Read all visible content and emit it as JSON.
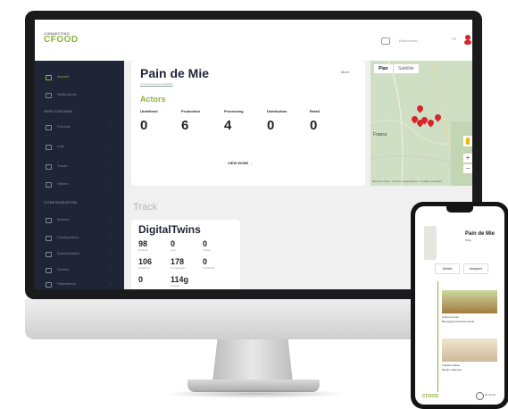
{
  "app": {
    "logo_top": "CONNECTING",
    "logo_main": "CFOOD",
    "search_placeholder": "Rechercher...",
    "language": "FR"
  },
  "sidebar": {
    "items_top": [
      {
        "label": "Accueil",
        "active": true
      },
      {
        "label": "Notifications",
        "active": false
      }
    ],
    "section_applications": "APPLICATIONS",
    "items_apps": [
      {
        "label": "Produits"
      },
      {
        "label": "Lots"
      },
      {
        "label": "Tracer"
      },
      {
        "label": "Visites"
      }
    ],
    "section_configuration": "CONFIGURATION",
    "items_config": [
      {
        "label": "Acteurs"
      },
      {
        "label": "Configuration"
      },
      {
        "label": "Administration"
      },
      {
        "label": "Gestion"
      },
      {
        "label": "Paramètres"
      }
    ]
  },
  "product": {
    "title": "Pain de Mie",
    "subtitle": "Connecting Food traçabilité",
    "more": "More",
    "actors_label": "Actors",
    "actors": [
      {
        "label": "Undefined",
        "value": "0"
      },
      {
        "label": "Production",
        "value": "6"
      },
      {
        "label": "Processing",
        "value": "4"
      },
      {
        "label": "Distribution",
        "value": "0"
      },
      {
        "label": "Retail",
        "value": "0"
      }
    ],
    "view_more": "VIEW MORE →"
  },
  "map": {
    "tab_plan": "Plan",
    "tab_satellite": "Satellite",
    "label_country": "France",
    "zoom_in": "+",
    "zoom_out": "−",
    "attribution": "Raccourcis clavier · Données cartographiques · Conditions d'utilisation"
  },
  "track": {
    "label": "Track",
    "title": "DigitalTwins",
    "stats": [
      {
        "value": "98",
        "label": "Produits"
      },
      {
        "value": "0",
        "label": "Lots"
      },
      {
        "value": "0",
        "label": "Visites"
      },
      {
        "value": "106",
        "label": "Créations"
      },
      {
        "value": "178",
        "label": "Composants"
      },
      {
        "value": "0",
        "label": "Transferts"
      },
      {
        "value": "0",
        "label": ""
      },
      {
        "value": "114g",
        "label": "CO2/an"
      }
    ]
  },
  "phone": {
    "title": "Pain de Mie",
    "subtitle": "500g",
    "btn_details": "Détails",
    "btn_analyses": "Analyses",
    "caption1": "Culture du blé",
    "caption1b": "Bourgogne Franche-Comté",
    "caption2": "Transformation",
    "caption2b": "Moulin Chaumet",
    "footer_logo": "CFOOD",
    "footer_text": "Blockchain"
  },
  "colors": {
    "accent": "#8ab43c",
    "sidebar": "#1f2537",
    "marker": "#d8232a"
  }
}
